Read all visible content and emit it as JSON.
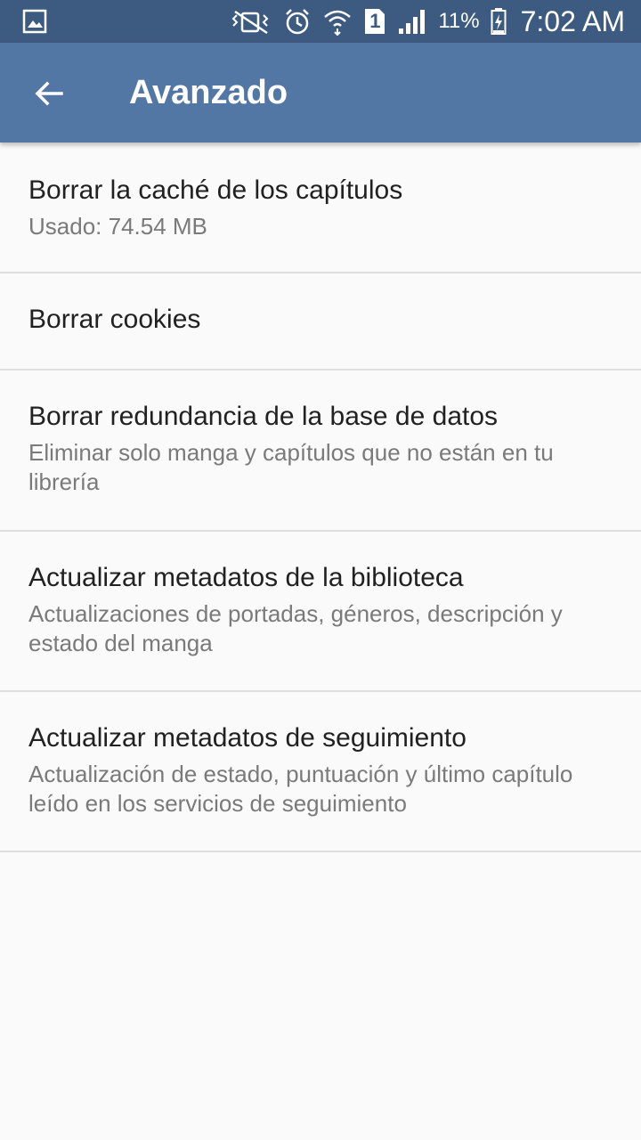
{
  "status_bar": {
    "battery_percent": "11%",
    "time": "7:02 AM",
    "sim_slot": "1",
    "icons": [
      "image-icon",
      "vibrate-icon",
      "alarm-icon",
      "wifi-icon",
      "sim-icon",
      "signal-icon",
      "battery-charging-icon"
    ]
  },
  "toolbar": {
    "title": "Avanzado",
    "back_icon": "arrow-back-icon"
  },
  "preferences": [
    {
      "title": "Borrar la caché de los capítulos",
      "summary": "Usado: 74.54 MB"
    },
    {
      "title": "Borrar cookies"
    },
    {
      "title": "Borrar redundancia de la base de datos",
      "summary": "Eliminar solo manga y capítulos que no están en tu librería"
    },
    {
      "title": "Actualizar metadatos de la biblioteca",
      "summary": "Actualizaciones de portadas, géneros, descripción y estado del manga"
    },
    {
      "title": "Actualizar metadatos de seguimiento",
      "summary": "Actualización de estado, puntuación y último capítulo leído en los servicios de seguimiento"
    }
  ],
  "colors": {
    "status_bar": "#3d5a80",
    "toolbar": "#5377a4",
    "background": "#fafafa",
    "title_text": "#212121",
    "summary_text": "#7a7a7a",
    "divider": "#dedede"
  }
}
